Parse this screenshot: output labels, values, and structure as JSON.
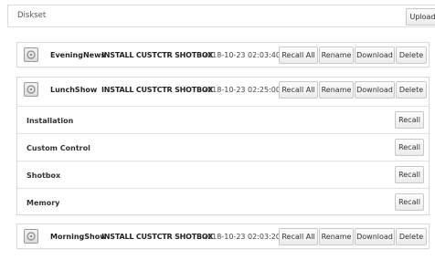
{
  "toolbar": {
    "title": "Diskset",
    "upload_label": "Upload"
  },
  "actions": {
    "recall_all": "Recall All",
    "rename": "Rename",
    "download": "Download",
    "delete": "Delete",
    "recall": "Recall"
  },
  "icons": {
    "disk": "disk-icon"
  },
  "cards": [
    {
      "name": "EveningNews",
      "install": "INSTALL CUSTCTR SHOTBOX",
      "timestamp": "2018-10-23 02:03:40"
    },
    {
      "name": "LunchShow",
      "install": "INSTALL CUSTCTR SHOTBOX",
      "timestamp": "2018-10-23 02:25:00",
      "items": [
        {
          "label": "Installation"
        },
        {
          "label": "Custom Control"
        },
        {
          "label": "Shotbox"
        },
        {
          "label": "Memory"
        }
      ]
    },
    {
      "name": "MorningShow",
      "install": "INSTALL CUSTCTR SHOTBOX",
      "timestamp": "2018-10-23 02:03:20"
    }
  ]
}
